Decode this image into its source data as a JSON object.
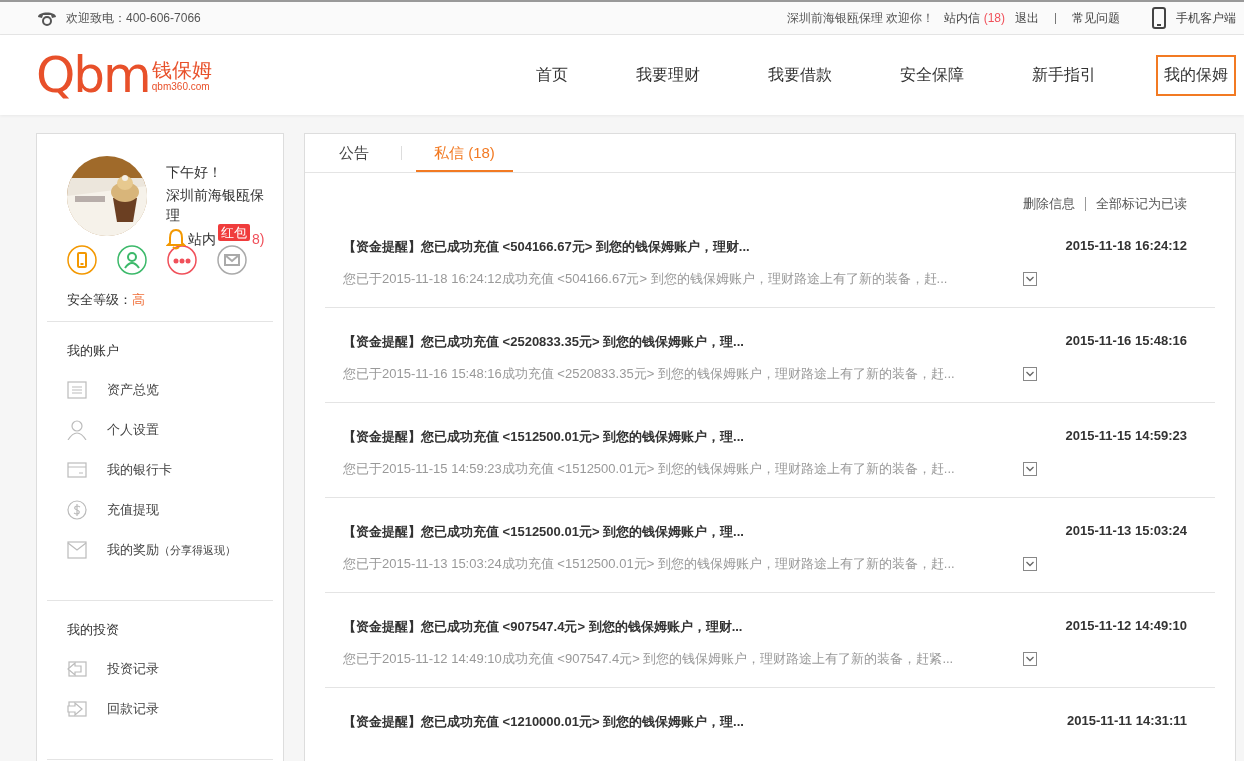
{
  "topbar": {
    "hotline": "欢迎致电：400-606-7066",
    "welcome": "深圳前海银瓯保理 欢迎你！",
    "inbox_label": "站内信",
    "inbox_count": "(18)",
    "logout": "退出",
    "faq": "常见问题",
    "mobile": "手机客户端"
  },
  "logo": {
    "mark": "Qbm",
    "name": "钱保姆",
    "domain": "qbm360.com"
  },
  "nav": [
    {
      "label": "首页",
      "selected": false
    },
    {
      "label": "我要理财",
      "selected": false
    },
    {
      "label": "我要借款",
      "selected": false
    },
    {
      "label": "安全保障",
      "selected": false
    },
    {
      "label": "新手指引",
      "selected": false
    },
    {
      "label": "我的保姆",
      "selected": true
    }
  ],
  "profile": {
    "greeting": "下午好！",
    "name": "深圳前海银瓯保理",
    "inbox_text": "站内",
    "badge": "红包",
    "inbox_rest": "8)",
    "security_label": "安全等级：",
    "security_value": "高"
  },
  "security_items": [
    {
      "kind": "phone",
      "on": true
    },
    {
      "kind": "identity",
      "on": true
    },
    {
      "kind": "password",
      "on": true
    },
    {
      "kind": "email",
      "on": false
    }
  ],
  "menu": [
    {
      "heading": "我的账户",
      "items": [
        {
          "kind": "overview",
          "label": "资产总览"
        },
        {
          "kind": "person",
          "label": "个人设置"
        },
        {
          "kind": "card",
          "label": "我的银行卡"
        },
        {
          "kind": "money",
          "label": "充值提现"
        },
        {
          "kind": "envelope",
          "label": "我的奖励",
          "note": "（分享得返现）"
        }
      ]
    },
    {
      "heading": "我的投资",
      "items": [
        {
          "kind": "out",
          "label": "投资记录"
        },
        {
          "kind": "in",
          "label": "回款记录"
        }
      ]
    }
  ],
  "tabs": [
    {
      "label": "公告",
      "selected": false
    },
    {
      "label": "私信 (18)",
      "selected": true
    }
  ],
  "actions": [
    "删除信息",
    "全部标记为已读"
  ],
  "messages": [
    {
      "title": "【资金提醒】您已成功充值 <504166.67元> 到您的钱保姆账户，理财...",
      "date": "2015-11-18 16:24:12",
      "summary": "您已于2015-11-18 16:24:12成功充值 <504166.67元> 到您的钱保姆账户，理财路途上有了新的装备，赶..."
    },
    {
      "title": "【资金提醒】您已成功充值 <2520833.35元> 到您的钱保姆账户，理...",
      "date": "2015-11-16 15:48:16",
      "summary": "您已于2015-11-16 15:48:16成功充值 <2520833.35元> 到您的钱保姆账户，理财路途上有了新的装备，赶..."
    },
    {
      "title": "【资金提醒】您已成功充值 <1512500.01元> 到您的钱保姆账户，理...",
      "date": "2015-11-15 14:59:23",
      "summary": "您已于2015-11-15 14:59:23成功充值 <1512500.01元> 到您的钱保姆账户，理财路途上有了新的装备，赶..."
    },
    {
      "title": "【资金提醒】您已成功充值 <1512500.01元> 到您的钱保姆账户，理...",
      "date": "2015-11-13 15:03:24",
      "summary": "您已于2015-11-13 15:03:24成功充值 <1512500.01元> 到您的钱保姆账户，理财路途上有了新的装备，赶..."
    },
    {
      "title": "【资金提醒】您已成功充值 <907547.4元> 到您的钱保姆账户，理财...",
      "date": "2015-11-12 14:49:10",
      "summary": "您已于2015-11-12 14:49:10成功充值 <907547.4元> 到您的钱保姆账户，理财路途上有了新的装备，赶紧..."
    },
    {
      "title": "【资金提醒】您已成功充值 <1210000.01元> 到您的钱保姆账户，理...",
      "date": "2015-11-11 14:31:11"
    }
  ]
}
